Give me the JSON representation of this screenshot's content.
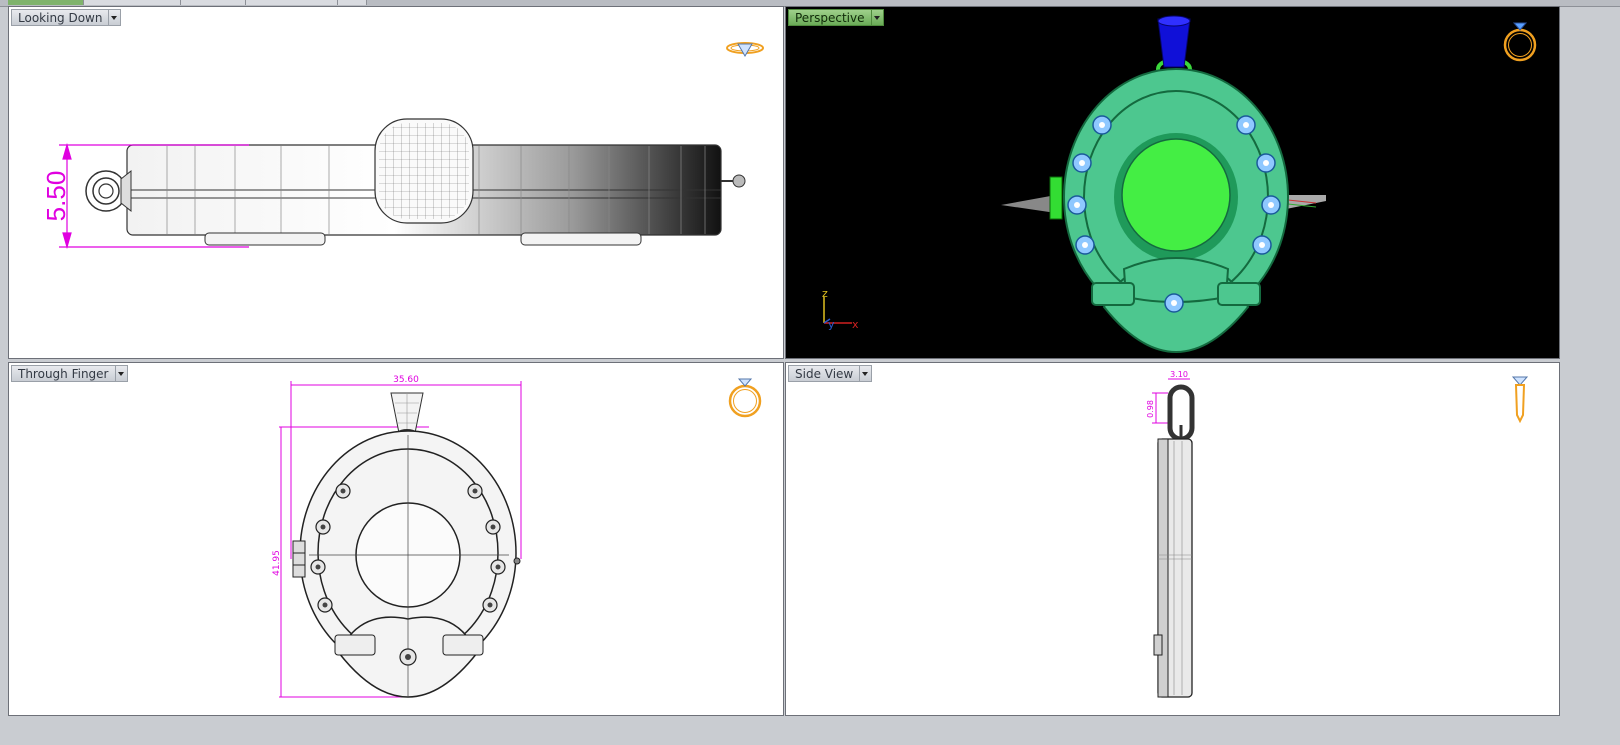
{
  "tabs": [
    "",
    "",
    "",
    "",
    ""
  ],
  "viewports": {
    "top_left": {
      "title": "Looking Down",
      "dimension": "5.50"
    },
    "top_right": {
      "title": "Perspective",
      "axes": {
        "z": "z",
        "y": "y",
        "x": "x"
      }
    },
    "bottom_left": {
      "title": "Through Finger",
      "width_dim": "35.60",
      "height_dim": "41.95"
    },
    "bottom_right": {
      "title": "Side View",
      "width_dim": "3.10",
      "height_dim": "0.98"
    }
  },
  "colors": {
    "dimension": "#e000e0",
    "pendant_body": "#4dc78f",
    "pendant_center": "#44ee44",
    "bail": "#1010d8",
    "stone": "#8fc8ff",
    "ring_icon": "#f0a020",
    "active_viewport": "#7fb36c"
  },
  "icons": {
    "top_left": "ring-top-icon",
    "top_right": "ring-front-icon",
    "bottom_left": "ring-front-icon",
    "bottom_right": "ring-side-icon"
  }
}
